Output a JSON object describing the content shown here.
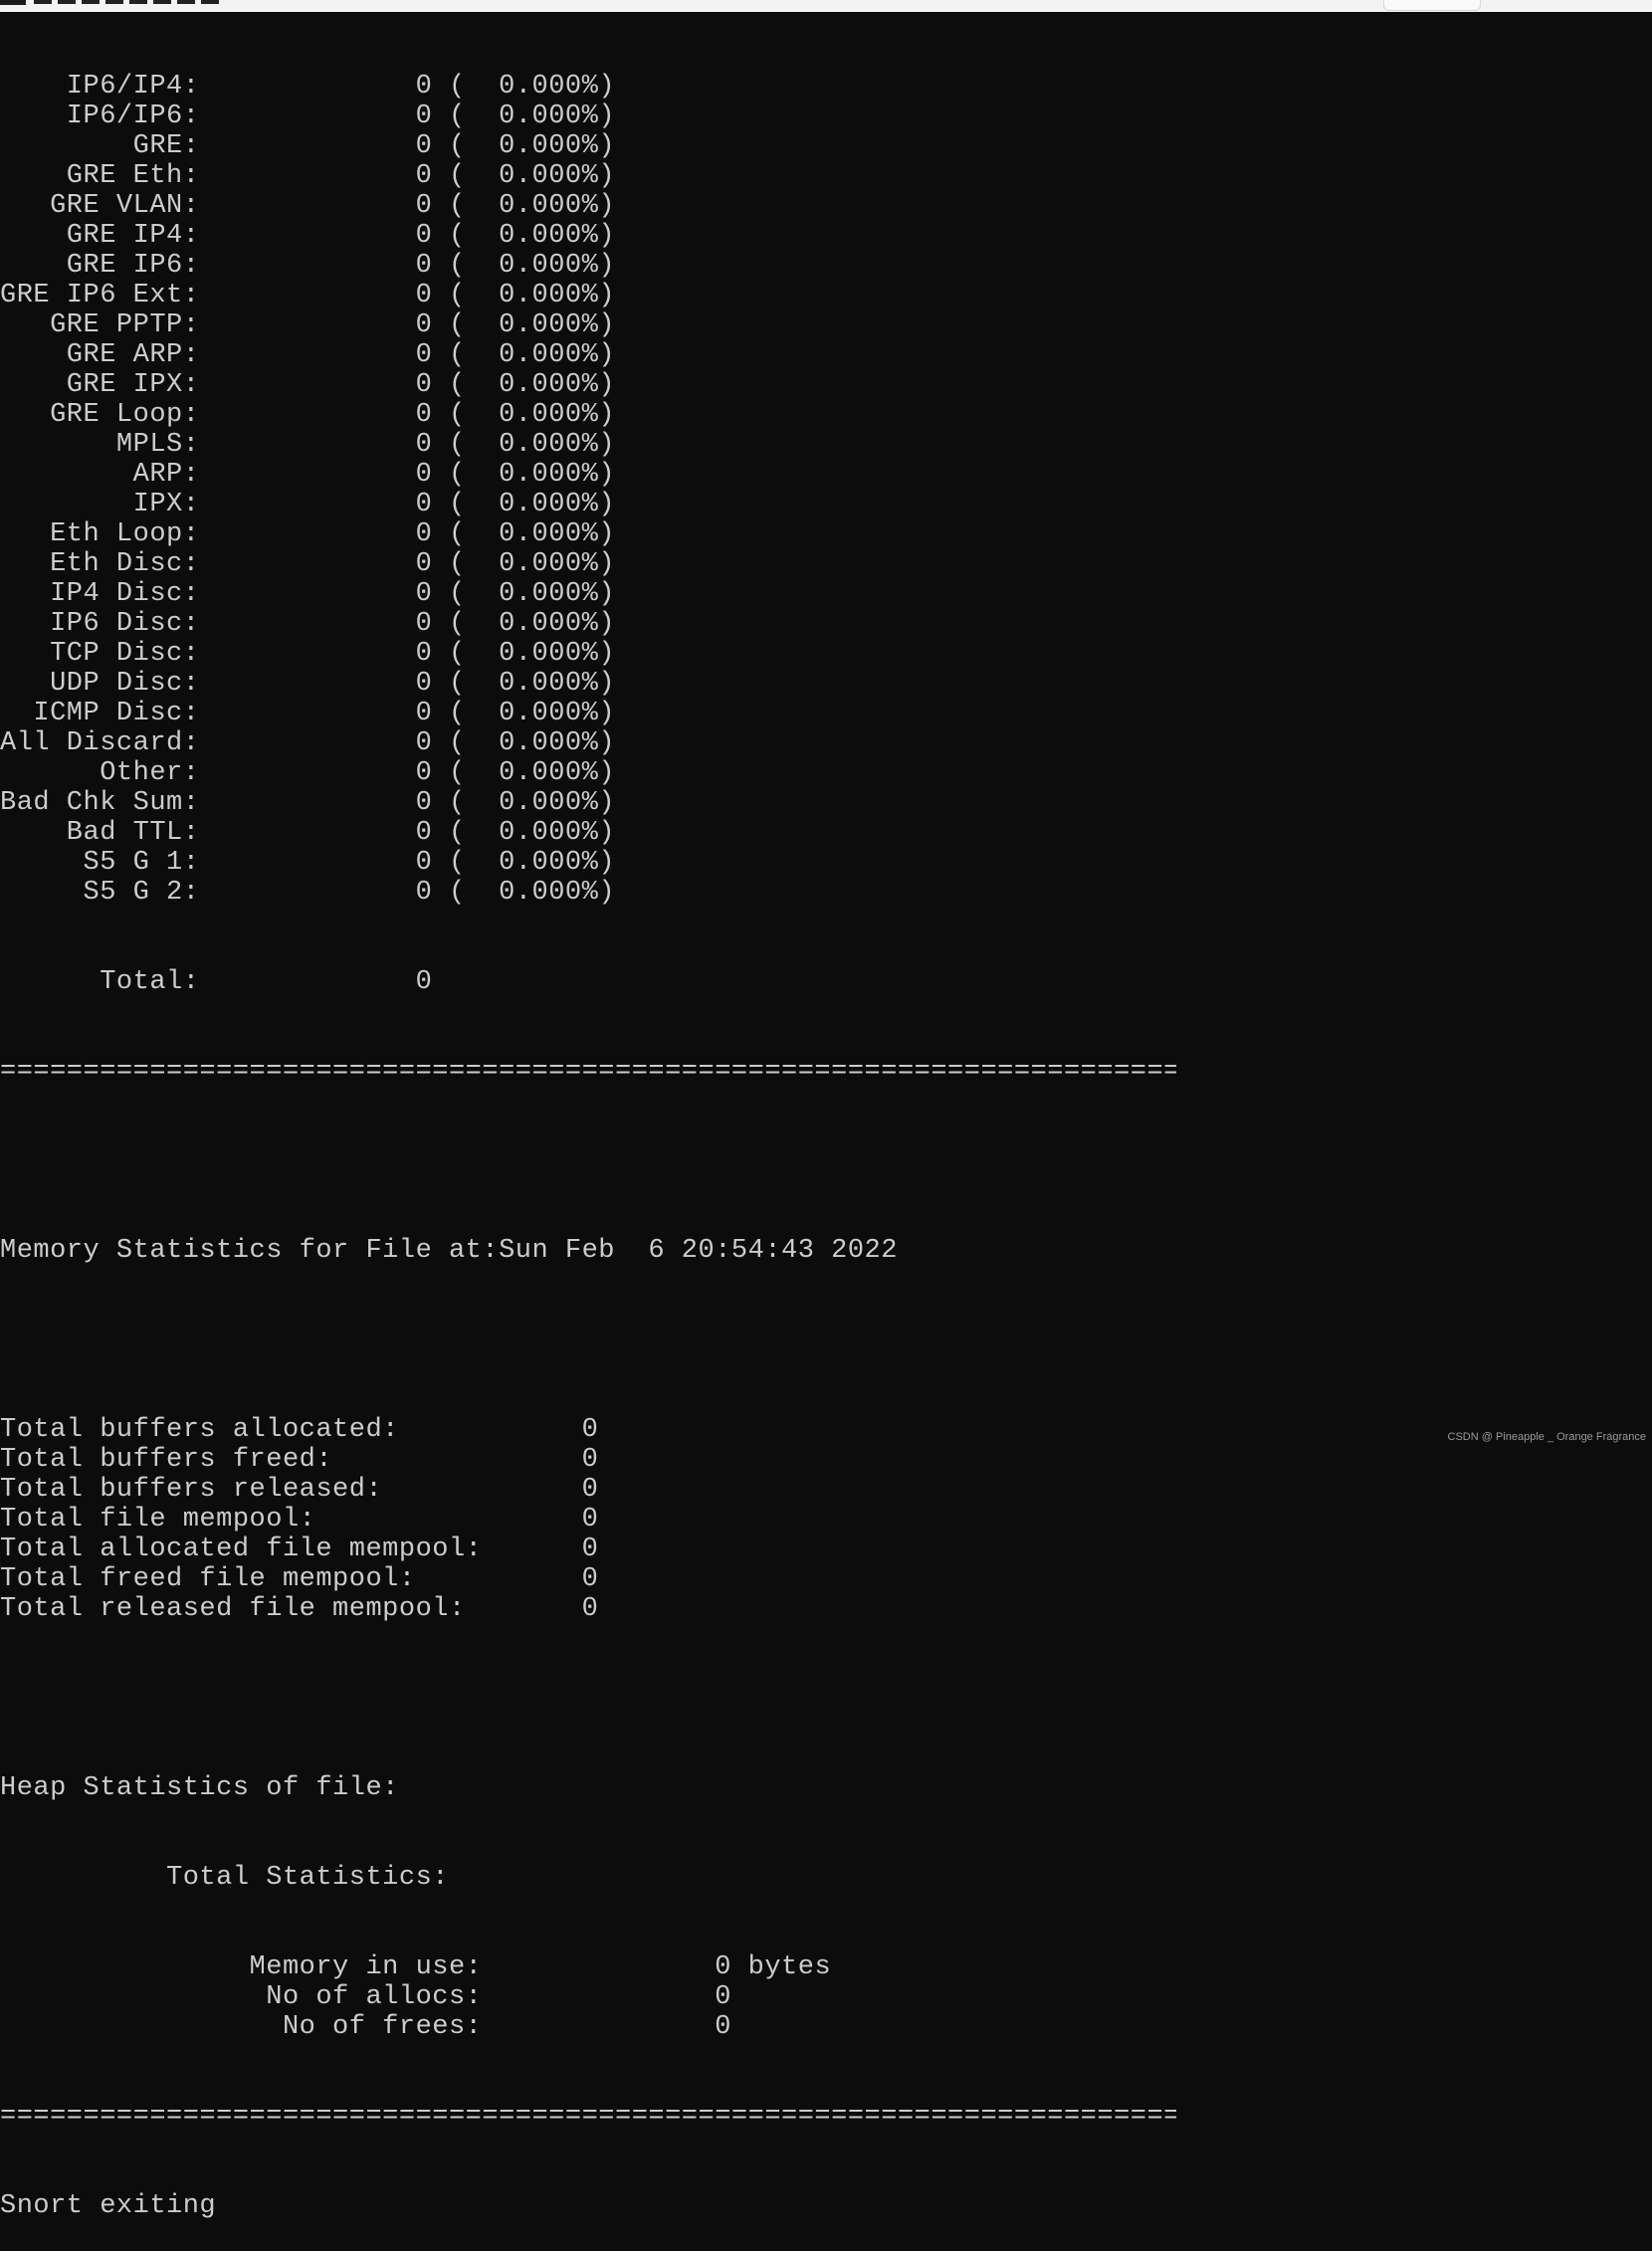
{
  "protocol_stats": [
    {
      "label": "IP6/IP4:",
      "count": "0",
      "pct": "0.000%"
    },
    {
      "label": "IP6/IP6:",
      "count": "0",
      "pct": "0.000%"
    },
    {
      "label": "GRE:",
      "count": "0",
      "pct": "0.000%"
    },
    {
      "label": "GRE Eth:",
      "count": "0",
      "pct": "0.000%"
    },
    {
      "label": "GRE VLAN:",
      "count": "0",
      "pct": "0.000%"
    },
    {
      "label": "GRE IP4:",
      "count": "0",
      "pct": "0.000%"
    },
    {
      "label": "GRE IP6:",
      "count": "0",
      "pct": "0.000%"
    },
    {
      "label": "GRE IP6 Ext:",
      "count": "0",
      "pct": "0.000%"
    },
    {
      "label": "GRE PPTP:",
      "count": "0",
      "pct": "0.000%"
    },
    {
      "label": "GRE ARP:",
      "count": "0",
      "pct": "0.000%"
    },
    {
      "label": "GRE IPX:",
      "count": "0",
      "pct": "0.000%"
    },
    {
      "label": "GRE Loop:",
      "count": "0",
      "pct": "0.000%"
    },
    {
      "label": "MPLS:",
      "count": "0",
      "pct": "0.000%"
    },
    {
      "label": "ARP:",
      "count": "0",
      "pct": "0.000%"
    },
    {
      "label": "IPX:",
      "count": "0",
      "pct": "0.000%"
    },
    {
      "label": "Eth Loop:",
      "count": "0",
      "pct": "0.000%"
    },
    {
      "label": "Eth Disc:",
      "count": "0",
      "pct": "0.000%"
    },
    {
      "label": "IP4 Disc:",
      "count": "0",
      "pct": "0.000%"
    },
    {
      "label": "IP6 Disc:",
      "count": "0",
      "pct": "0.000%"
    },
    {
      "label": "TCP Disc:",
      "count": "0",
      "pct": "0.000%"
    },
    {
      "label": "UDP Disc:",
      "count": "0",
      "pct": "0.000%"
    },
    {
      "label": "ICMP Disc:",
      "count": "0",
      "pct": "0.000%"
    },
    {
      "label": "All Discard:",
      "count": "0",
      "pct": "0.000%"
    },
    {
      "label": "Other:",
      "count": "0",
      "pct": "0.000%"
    },
    {
      "label": "Bad Chk Sum:",
      "count": "0",
      "pct": "0.000%"
    },
    {
      "label": "Bad TTL:",
      "count": "0",
      "pct": "0.000%"
    },
    {
      "label": "S5 G 1:",
      "count": "0",
      "pct": "0.000%"
    },
    {
      "label": "S5 G 2:",
      "count": "0",
      "pct": "0.000%"
    }
  ],
  "protocol_total": {
    "label": "Total:",
    "count": "0"
  },
  "separator": "===============================================================================",
  "memory": {
    "header": "Memory Statistics for File at:Sun Feb  6 20:54:43 2022",
    "rows": [
      {
        "label": "Total buffers allocated:",
        "value": "0"
      },
      {
        "label": "Total buffers freed:",
        "value": "0"
      },
      {
        "label": "Total buffers released:",
        "value": "0"
      },
      {
        "label": "Total file mempool:",
        "value": "0"
      },
      {
        "label": "Total allocated file mempool:",
        "value": "0"
      },
      {
        "label": "Total freed file mempool:",
        "value": "0"
      },
      {
        "label": "Total released file mempool:",
        "value": "0"
      }
    ]
  },
  "heap": {
    "header": "Heap Statistics of file:",
    "subheader": "Total Statistics:",
    "rows": [
      {
        "label": "Memory in use:",
        "value": "0 bytes"
      },
      {
        "label": "No of allocs:",
        "value": "0"
      },
      {
        "label": "No of frees:",
        "value": "0"
      }
    ]
  },
  "exit_message": "Snort exiting",
  "watermark": "CSDN @ Pineapple _ Orange Fragrance"
}
